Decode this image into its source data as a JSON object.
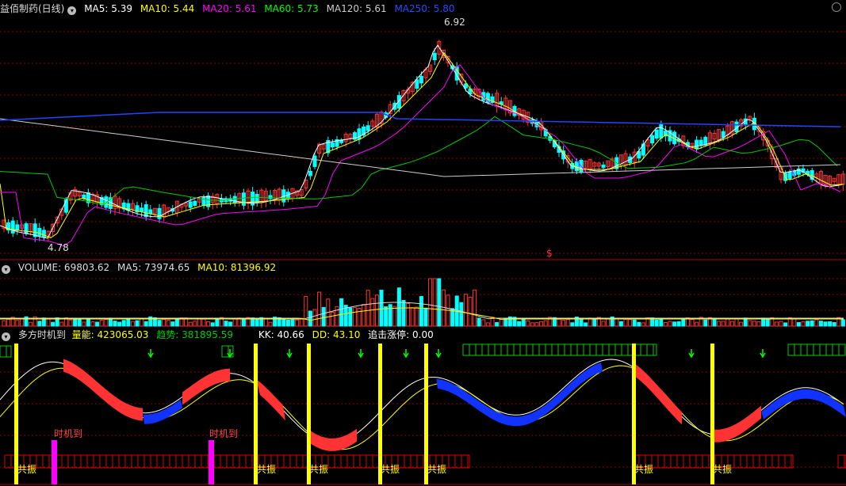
{
  "main_panel": {
    "title": "益佰制药(日线)",
    "indicators": [
      {
        "label": "MA5: 5.39",
        "color": "#ffffff"
      },
      {
        "label": "MA10: 5.44",
        "color": "#ffff00"
      },
      {
        "label": "MA20: 5.61",
        "color": "#ff00ff"
      },
      {
        "label": "MA60: 5.73",
        "color": "#00ff00"
      },
      {
        "label": "MA120: 5.61",
        "color": "#cccccc"
      },
      {
        "label": "MA250: 5.80",
        "color": "#2244ff"
      }
    ],
    "high_marker": "6.92",
    "low_marker": "4.78",
    "dollar_marker": "$"
  },
  "volume_panel": {
    "indicators": [
      {
        "label": "VOLUME: 69803.62",
        "color": "#dddddd"
      },
      {
        "label": "MA5: 73974.65",
        "color": "#dddddd"
      },
      {
        "label": "MA10: 81396.92",
        "color": "#ffff00"
      }
    ]
  },
  "indicator_panel": {
    "title": "多方时机到",
    "indicators": [
      {
        "label": "量能: 423065.03",
        "color": "#ffff00"
      },
      {
        "label": "趋势: 381895.59",
        "color": "#00cc00"
      },
      {
        "label": "KK: 40.66",
        "color": "#ffffff"
      },
      {
        "label": "DD: 43.10",
        "color": "#ffff00"
      },
      {
        "label": "追击涨停: 0.00",
        "color": "#ffffff"
      }
    ],
    "signal_label": "时机到",
    "resonance_label": "共振"
  },
  "colors": {
    "up": "#ff3333",
    "down": "#00ffff",
    "grid": "#8b0000",
    "signal_bar": "#ffff00",
    "magenta_bar": "#ff00ff",
    "green_arrow": "#00ff00"
  }
}
